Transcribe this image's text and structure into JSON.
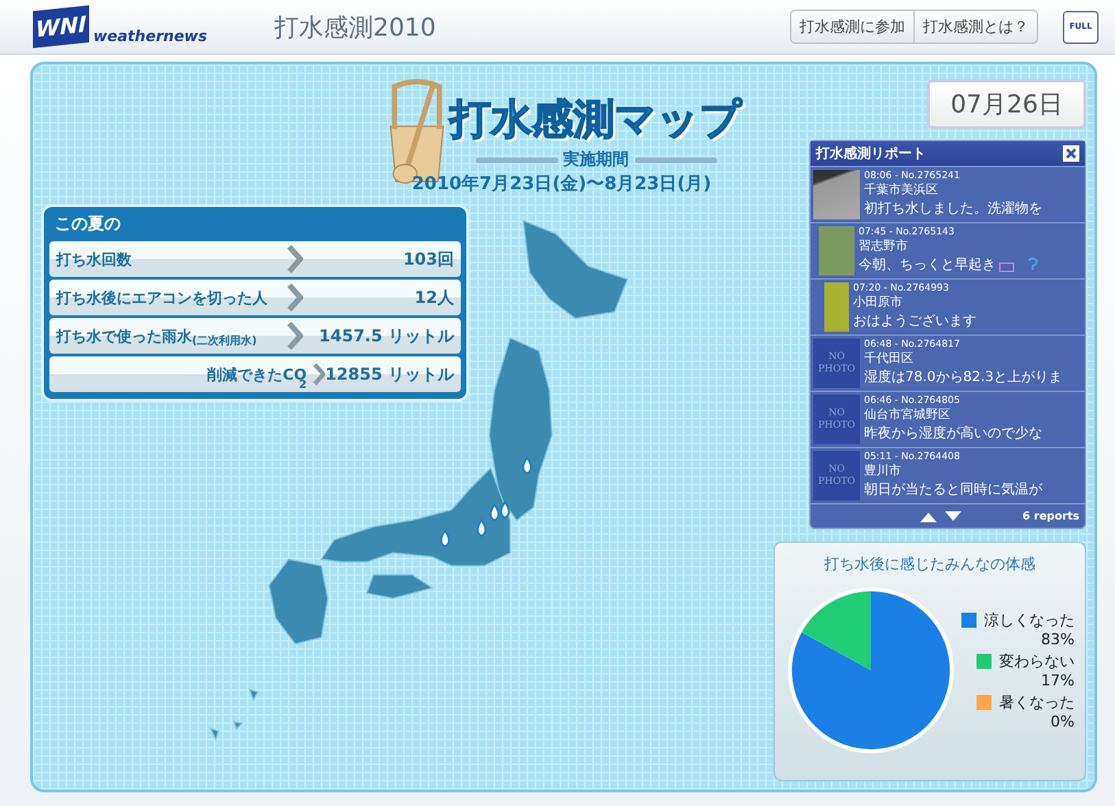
{
  "header": {
    "logo_mark": "WNI",
    "logo_text": "weathernews",
    "title": "打水感測2010",
    "buttons": [
      {
        "label": "打水感測に参加"
      },
      {
        "label": "打水感測とは？"
      }
    ],
    "full_button": "FULL"
  },
  "hero": {
    "title": "打水感測マップ",
    "period_label": "実施期間",
    "period": "2010年7月23日(金)〜8月23日(月)"
  },
  "date": "07月26日",
  "summary": {
    "title": "この夏の",
    "rows": [
      {
        "label": "打ち水回数",
        "value": "103回"
      },
      {
        "label": "打ち水後にエアコンを切った人",
        "value": "12人"
      },
      {
        "label": "打ち水で使った雨水$_{(二次利用水)}$",
        "value": "1457.5 リットル"
      },
      {
        "label": "削減できたCO$_{2}$",
        "value": "12855 リットル"
      }
    ]
  },
  "reports": {
    "title": "打水感測リポート",
    "items": [
      {
        "kind": "photo",
        "meta": "08:06 - No.2765241",
        "place": "千葉市美浜区",
        "text": "初打ち水しました。洗濯物を",
        "emoji": false
      },
      {
        "kind": "photo",
        "meta": "07:45 - No.2765143",
        "place": "習志野市",
        "text": "今朝、ちっくと早起き",
        "emoji": true
      },
      {
        "kind": "photo",
        "meta": "07:20 - No.2764993",
        "place": "小田原市",
        "text": "おはようございます",
        "emoji": false
      },
      {
        "kind": "nophoto",
        "thumb_text": "NO PHOTO",
        "meta": "06:48 - No.2764817",
        "place": "千代田区",
        "text": "湿度は78.0から82.3と上がりま",
        "emoji": false
      },
      {
        "kind": "nophoto",
        "thumb_text": "NO PHOTO",
        "meta": "06:46 - No.2764805",
        "place": "仙台市宮城野区",
        "text": "昨夜から湿度が高いので少な",
        "emoji": false
      },
      {
        "kind": "nophoto",
        "thumb_text": "NO PHOTO",
        "meta": "05:11 - No.2764408",
        "place": "豊川市",
        "text": "朝日が当たると同時に気温が",
        "emoji": false
      }
    ],
    "count": "6 reports"
  },
  "feeling": {
    "title": "打ち水後に感じたみんなの体感",
    "chart_data": {
      "type": "pie",
      "categories": [
        "涼しくなった",
        "変わらない",
        "暑くなった"
      ],
      "values": [
        83,
        17,
        0
      ],
      "legend": "right",
      "colors": [
        "#1a80e6",
        "#22cc77",
        "#ffa64d"
      ],
      "value_labels": [
        "83%",
        "17%",
        "0%"
      ]
    }
  }
}
